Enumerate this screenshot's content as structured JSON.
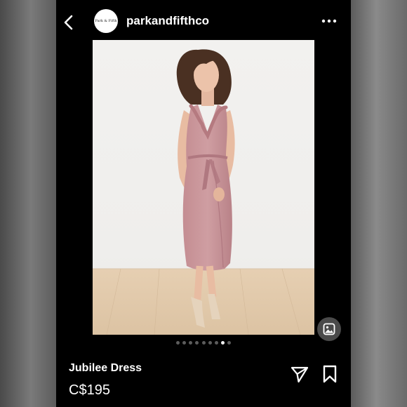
{
  "header": {
    "username": "parkandfifthco",
    "avatar_text": "Park & Fifth"
  },
  "icons": {
    "back": "chevron-left-icon",
    "more": "more-horizontal-icon",
    "image": "image-icon",
    "share": "send-icon",
    "bookmark": "bookmark-icon"
  },
  "carousel": {
    "total": 9,
    "active_index": 7
  },
  "product": {
    "title": "Jubilee Dress",
    "price": "C$195"
  },
  "colors": {
    "background": "#000000",
    "text": "#ffffff",
    "dress": "#c9969a"
  }
}
